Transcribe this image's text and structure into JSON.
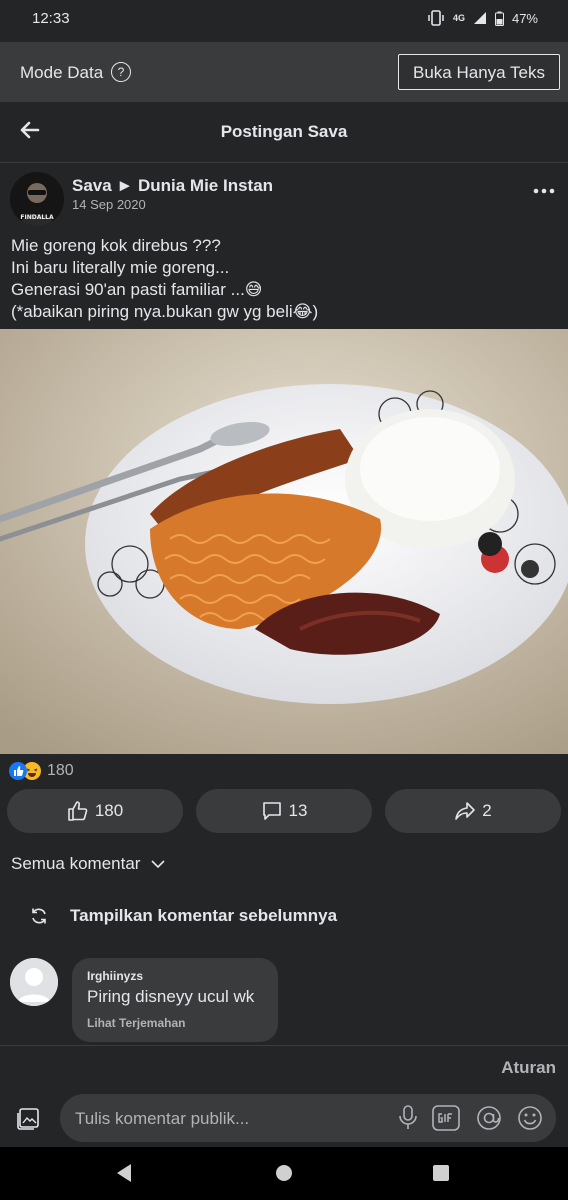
{
  "status_bar": {
    "time": "12:33",
    "network": "4G",
    "battery": "47%"
  },
  "data_mode": {
    "label": "Mode Data",
    "help": "?",
    "button": "Buka Hanya Teks"
  },
  "header": {
    "title": "Postingan Sava"
  },
  "post": {
    "author": "Sava ► Dunia Mie Instan",
    "date": "14 Sep 2020",
    "lines": [
      "Mie goreng kok direbus ???",
      "Ini baru literally mie goreng...",
      "Generasi 90'an pasti familiar ...😅",
      "(*abaikan piring nya.bukan gw yg beli😂)"
    ],
    "avatar_text": "FINDALLA"
  },
  "reactions": {
    "summary_count": "180"
  },
  "actions": {
    "like_count": "180",
    "comment_count": "13",
    "share_count": "2"
  },
  "comments": {
    "filter_label": "Semua komentar",
    "prev_label": "Tampilkan komentar sebelumnya",
    "items": [
      {
        "name": "Irghiinyzs",
        "text": "Piring disneyy ucul wk",
        "translate": "Lihat Terjemahan"
      }
    ]
  },
  "rules_label": "Aturan",
  "composer": {
    "placeholder": "Tulis komentar publik..."
  },
  "colors": {
    "background": "#242526",
    "surface": "#3a3b3c",
    "text": "#e4e6eb",
    "muted": "#b0b3b8",
    "like_blue": "#1877f2",
    "haha_yellow": "#f7b928"
  }
}
